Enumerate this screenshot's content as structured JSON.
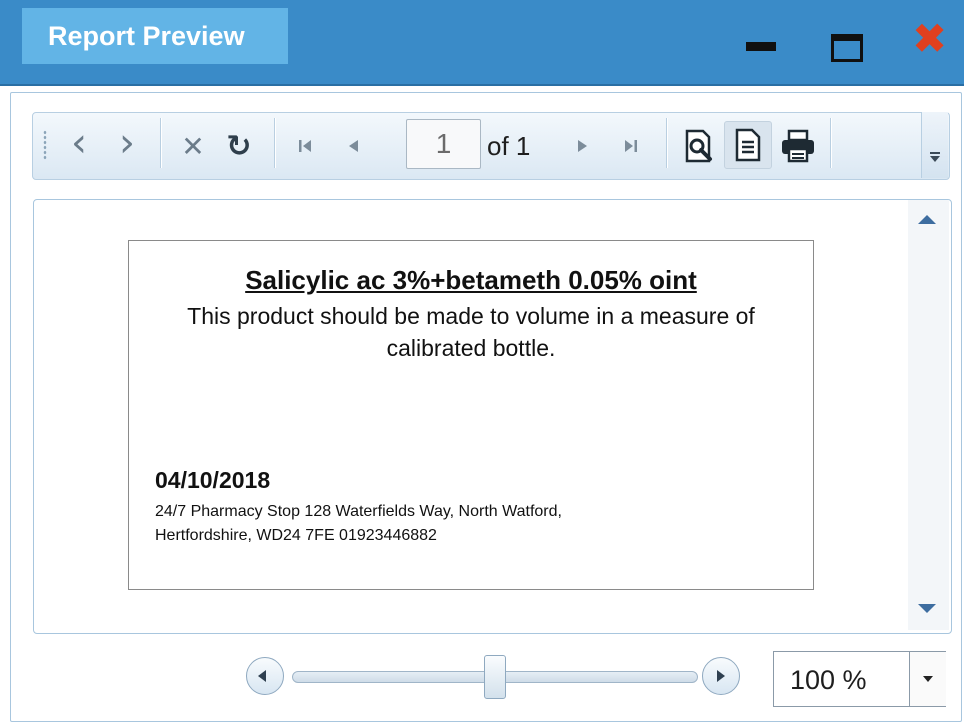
{
  "window": {
    "title": "Report Preview",
    "minimize_icon": "minimize-icon",
    "maximize_icon": "maximize-icon",
    "close_icon": "close-icon",
    "close_symbol": "✖",
    "accent_color": "#3a8bc8"
  },
  "toolbar": {
    "back_symbol": "‹",
    "forward_symbol": "›",
    "stop_symbol": "✕",
    "refresh_symbol": "↻",
    "current_page": "1",
    "page_total_text": "of 1",
    "icons": [
      "back-icon",
      "forward-icon",
      "stop-icon",
      "refresh-icon",
      "first-page-icon",
      "previous-page-icon",
      "next-page-icon",
      "last-page-icon",
      "print-preview-icon",
      "page-setup-icon",
      "print-icon"
    ]
  },
  "report": {
    "title": "Salicylic ac 3%+betameth 0.05% oint",
    "description": "This product should be made to volume in a measure of calibrated bottle.",
    "date": "04/10/2018",
    "address": "24/7 Pharmacy Stop 128 Waterfields Way, North Watford, Hertfordshire, WD24 7FE 01923446882"
  },
  "zoom": {
    "value": "100 %",
    "slider_level": 0.5
  }
}
